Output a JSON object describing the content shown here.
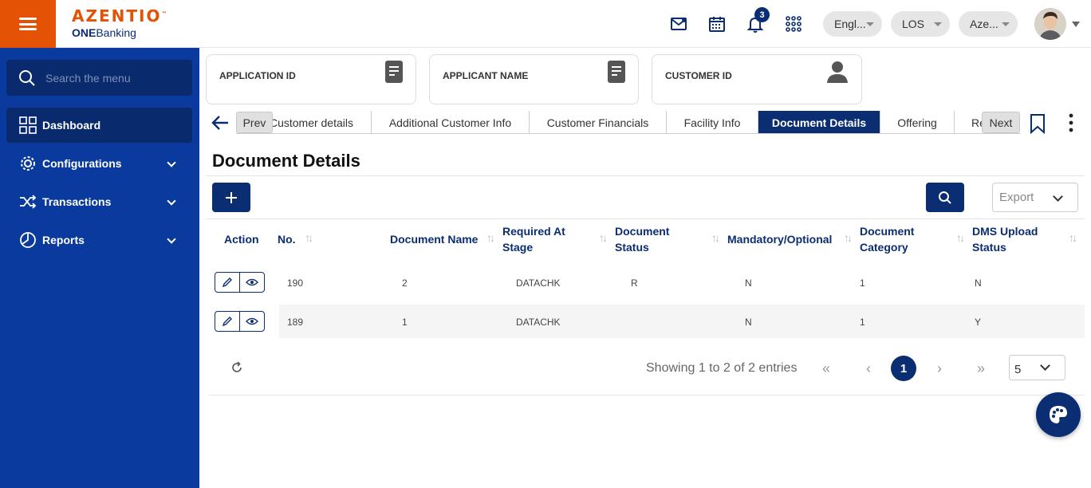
{
  "header": {
    "brand": "AZENTIO",
    "brand_tm": "™",
    "product_prefix": "ONE",
    "product_suffix": "Banking",
    "notification_count": "3",
    "language": "Engl...",
    "module": "LOS",
    "entity": "Aze...",
    "icons": [
      "mail-icon",
      "calendar-icon",
      "bell-icon",
      "apps-grid-icon"
    ]
  },
  "sidebar": {
    "search_placeholder": "Search the menu",
    "items": [
      {
        "label": "Dashboard",
        "icon": "dashboard-icon"
      },
      {
        "label": "Configurations",
        "icon": "gear-icon"
      },
      {
        "label": "Transactions",
        "icon": "shuffle-icon"
      },
      {
        "label": "Reports",
        "icon": "pie-chart-icon"
      }
    ]
  },
  "cards": {
    "application_id": "APPLICATION ID",
    "applicant_name": "APPLICANT NAME",
    "customer_id": "CUSTOMER ID"
  },
  "tabs": {
    "prev": "Prev",
    "next": "Next",
    "items": [
      "Customer details",
      "Additional Customer Info",
      "Customer Financials",
      "Facility Info",
      "Document Details",
      "Offering",
      "Re"
    ],
    "active": "Document Details"
  },
  "page": {
    "title": "Document Details",
    "export_label": "Export"
  },
  "table": {
    "columns": [
      {
        "line1": "Action",
        "line2": ""
      },
      {
        "line1": "No.",
        "line2": ""
      },
      {
        "line1": "Document Name",
        "line2": ""
      },
      {
        "line1": "Required At",
        "line2": "Stage"
      },
      {
        "line1": "Document",
        "line2": "Status"
      },
      {
        "line1": "Mandatory/Optional",
        "line2": ""
      },
      {
        "line1": "Document",
        "line2": "Category"
      },
      {
        "line1": "DMS Upload",
        "line2": "Status"
      }
    ],
    "rows": [
      {
        "no": "190",
        "name": "2",
        "stage": "DATACHK",
        "status": "R",
        "mandatory": "N",
        "category": "1",
        "dms": "N"
      },
      {
        "no": "189",
        "name": "1",
        "stage": "DATACHK",
        "status": "",
        "mandatory": "N",
        "category": "1",
        "dms": "Y"
      }
    ]
  },
  "pagination": {
    "showing": "Showing 1 to 2 of 2 entries",
    "current_page": "1",
    "first": "«",
    "prev": "‹",
    "next": "›",
    "last": "»",
    "page_size": "5"
  },
  "colors": {
    "brand_orange": "#e35205",
    "navy": "#0b2d72",
    "sidebar_blue": "#0b3a9e"
  }
}
